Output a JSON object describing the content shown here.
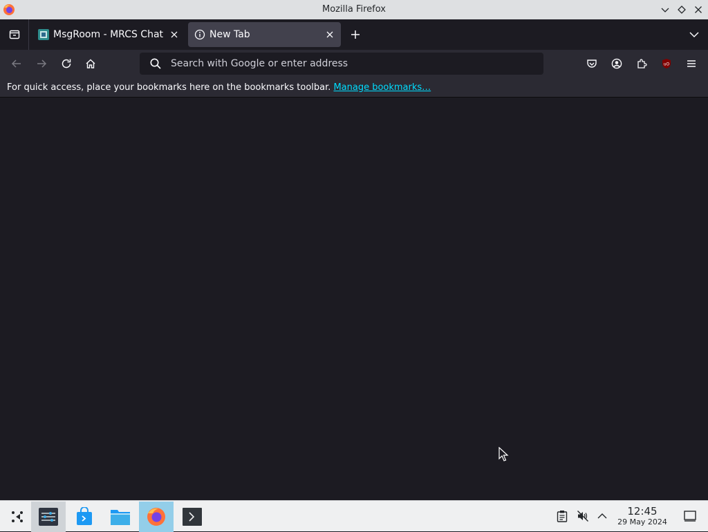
{
  "window": {
    "title": "Mozilla Firefox"
  },
  "tabs": [
    {
      "label": "MsgRoom - MRCS Chat",
      "favicon": "msgroom-favicon",
      "active": false
    },
    {
      "label": "New Tab",
      "favicon": "info-icon",
      "active": true
    }
  ],
  "urlbar": {
    "placeholder": "Search with Google or enter address",
    "value": ""
  },
  "bookmarks_toolbar": {
    "message": "For quick access, place your bookmarks here on the bookmarks toolbar.",
    "link": "Manage bookmarks…"
  },
  "toolbar_icons": [
    "back-icon",
    "forward-icon",
    "reload-icon",
    "home-icon",
    "pocket-icon",
    "account-icon",
    "extensions-icon",
    "ublock-icon",
    "menu-icon"
  ],
  "taskbar": {
    "apps": [
      "app-launcher",
      "system-settings",
      "discover",
      "dolphin-files",
      "firefox",
      "konsole"
    ],
    "clock": {
      "time": "12:45",
      "date": "29 May 2024"
    }
  },
  "colors": {
    "tab_bar_bg": "#1c1b22",
    "toolbar_bg": "#2b2a33",
    "active_tab_bg": "#42414d",
    "link": "#00ddff",
    "taskbar_bg": "#eff0f1",
    "current_task_bg": "#93cee9"
  }
}
